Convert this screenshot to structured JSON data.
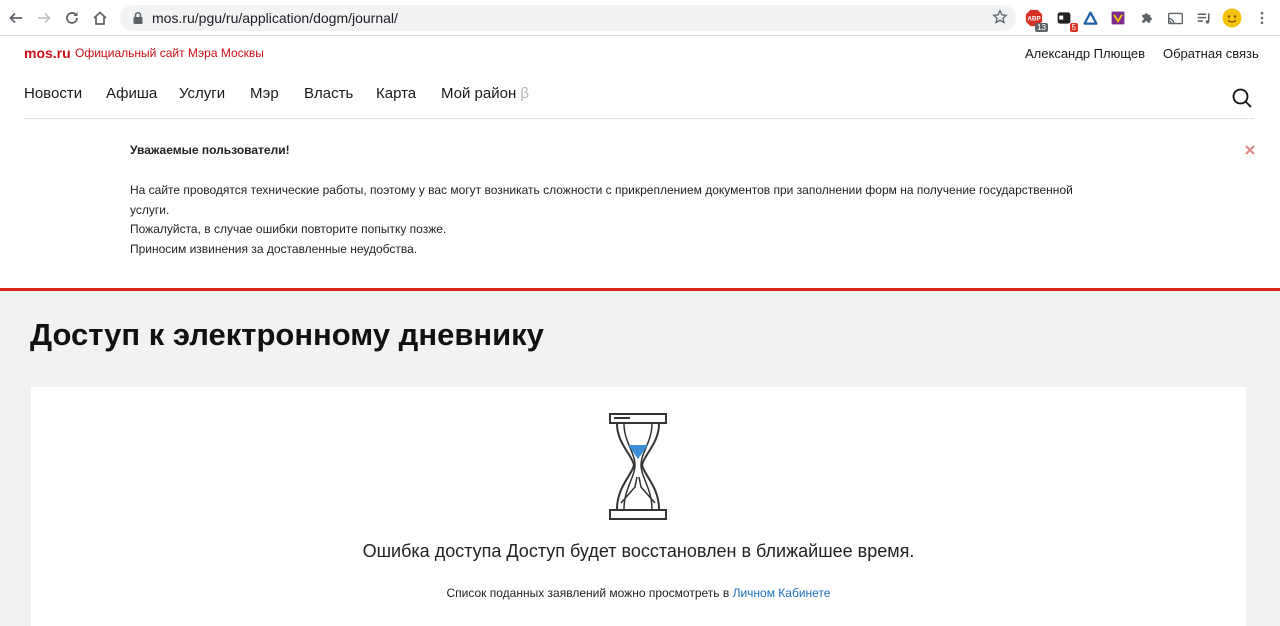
{
  "browser": {
    "url": "mos.ru/pgu/ru/application/dogm/journal/",
    "extensions": [
      {
        "name": "adblock-extension",
        "badge": "13",
        "color": "#d93025"
      },
      {
        "name": "dark-mode-extension",
        "badge": "5",
        "color": "#222222"
      },
      {
        "name": "triangle-extension",
        "badge": "",
        "color": "#1e5fa8"
      },
      {
        "name": "purple-extension",
        "badge": "",
        "color": "#7b2a8e"
      },
      {
        "name": "puzzle-extension",
        "badge": "",
        "color": "#5f6368"
      },
      {
        "name": "cast-extension",
        "badge": "",
        "color": "#5f6368"
      },
      {
        "name": "playlist-extension",
        "badge": "",
        "color": "#5f6368"
      }
    ]
  },
  "header": {
    "logo": "mos.ru",
    "tagline": "Официальный сайт Мэра Москвы",
    "user_name": "Александр Плющев",
    "feedback": "Обратная связь",
    "brand_color": "#cc0e18"
  },
  "nav": {
    "items": [
      {
        "label": "Новости"
      },
      {
        "label": "Афиша"
      },
      {
        "label": "Услуги"
      },
      {
        "label": "Мэр"
      },
      {
        "label": "Власть"
      },
      {
        "label": "Карта"
      },
      {
        "label": "Мой район",
        "suffix": "β"
      }
    ]
  },
  "notice": {
    "title": "Уважаемые пользователи!",
    "lines": [
      "На сайте проводятся технические работы, поэтому у вас могут возникать сложности с прикреплением документов при заполнении форм на получение государственной",
      "услуги.",
      "Пожалуйста, в случае ошибки повторите попытку позже.",
      "Приносим извинения за доставленные неудобства."
    ]
  },
  "main": {
    "title": "Доступ к электронному дневнику",
    "error_text": "Ошибка доступа Доступ будет восстановлен в ближайшее время.",
    "cabinet_prefix": "Список поданных заявлений можно просмотреть в ",
    "cabinet_link": "Личном Кабинете"
  }
}
